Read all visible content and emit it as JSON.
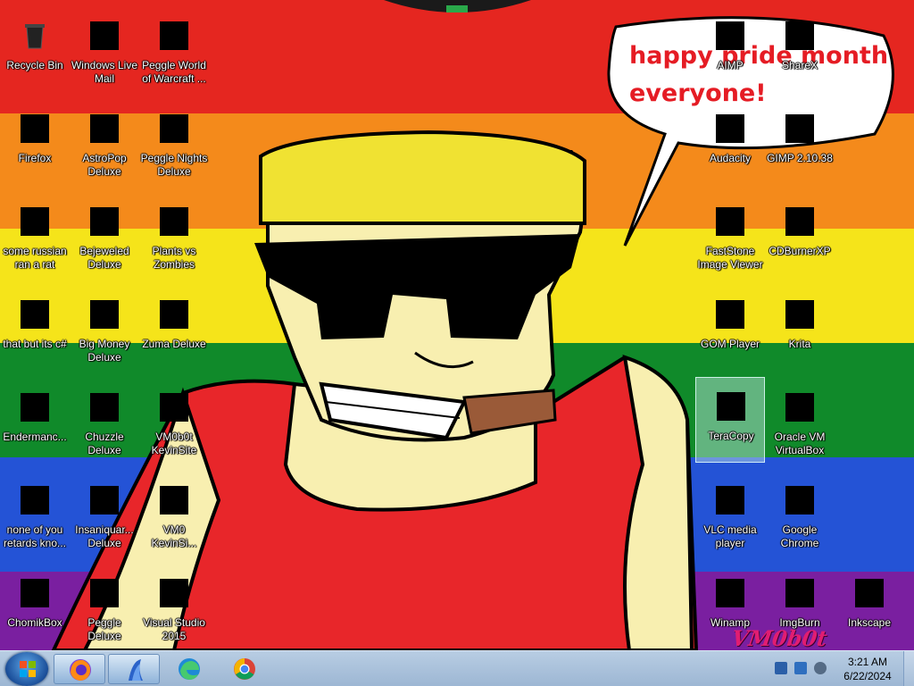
{
  "wallpaper": {
    "speech_line1": "happy pride month",
    "speech_line2": "everyone!",
    "signature": "VM0b0t",
    "stripe_colors": [
      "#e52620",
      "#f48a1b",
      "#f5e41a",
      "#108a2a",
      "#2453d6",
      "#7a1fa0"
    ]
  },
  "icons": {
    "recycle_bin": {
      "label": "Recycle Bin",
      "icon": "recycle-bin-icon"
    },
    "windows_live_mail": {
      "label": "Windows Live\nMail",
      "icon": "mail-icon"
    },
    "peggle_world_of_warcraft": {
      "label": "Peggle World\nof Warcraft ...",
      "icon": "game-icon"
    },
    "firefox": {
      "label": "Firefox",
      "icon": "firefox-icon"
    },
    "astropop": {
      "label": "AstroPop\nDeluxe",
      "icon": "game-icon"
    },
    "peggle_nights": {
      "label": "Peggle Nights\nDeluxe",
      "icon": "game-icon"
    },
    "some_russian": {
      "label": "some russian\nran a rat",
      "icon": "file-icon"
    },
    "bejeweled": {
      "label": "Bejeweled\nDeluxe",
      "icon": "game-icon"
    },
    "plants_vs_zombies": {
      "label": "Plants vs\nZombies",
      "icon": "game-icon"
    },
    "that_but_its_cs": {
      "label": "that but its c#",
      "icon": "file-icon"
    },
    "big_money": {
      "label": "Big Money\nDeluxe",
      "icon": "game-icon"
    },
    "zuma": {
      "label": "Zuma Deluxe",
      "icon": "game-icon"
    },
    "endermanc": {
      "label": "Endermanc...",
      "icon": "app-icon"
    },
    "chuzzle": {
      "label": "Chuzzle\nDeluxe",
      "icon": "game-icon"
    },
    "vm0b0t_kevinsite": {
      "label": "VM0b0t\nKevinSite",
      "icon": "folder-icon"
    },
    "none_of_you": {
      "label": "none of you\nretards kno...",
      "icon": "file-icon"
    },
    "insaniquarium": {
      "label": "Insaniquar...\nDeluxe",
      "icon": "game-icon"
    },
    "vm0_kevinsi": {
      "label": "VM0\nKevinSi...",
      "icon": "file-icon"
    },
    "chomikbox": {
      "label": "ChomikBox",
      "icon": "app-icon"
    },
    "peggle_deluxe": {
      "label": "Peggle Deluxe",
      "icon": "game-icon"
    },
    "visual_studio": {
      "label": "Visual Studio\n2015",
      "icon": "visual-studio-icon"
    },
    "aimp": {
      "label": "AIMP",
      "icon": "aimp-icon"
    },
    "sharex": {
      "label": "ShareX",
      "icon": "sharex-icon"
    },
    "audacity": {
      "label": "Audacity",
      "icon": "audacity-icon"
    },
    "gimp": {
      "label": "GIMP 2.10.38",
      "icon": "gimp-icon"
    },
    "faststone": {
      "label": "FastStone\nImage Viewer",
      "icon": "image-viewer-icon"
    },
    "cdburnerxp": {
      "label": "CDBurnerXP",
      "icon": "disc-icon"
    },
    "gom_player": {
      "label": "GOM Player",
      "icon": "media-player-icon"
    },
    "krita": {
      "label": "Krita",
      "icon": "krita-icon"
    },
    "teracopy": {
      "label": "TeraCopy",
      "icon": "teracopy-icon"
    },
    "virtualbox": {
      "label": "Oracle VM\nVirtualBox",
      "icon": "virtualbox-icon"
    },
    "vlc": {
      "label": "VLC media\nplayer",
      "icon": "vlc-icon"
    },
    "chrome": {
      "label": "Google\nChrome",
      "icon": "chrome-icon"
    },
    "winamp": {
      "label": "Winamp",
      "icon": "winamp-icon"
    },
    "imgburn": {
      "label": "ImgBurn",
      "icon": "disc-icon"
    },
    "inkscape": {
      "label": "Inkscape",
      "icon": "inkscape-icon"
    }
  },
  "taskbar": {
    "start": "start-orb-icon",
    "pinned": [
      "firefox-icon",
      "app-icon",
      "edge-icon",
      "chrome-icon"
    ],
    "clock_time": "3:21 AM",
    "clock_date": "6/22/2024"
  }
}
